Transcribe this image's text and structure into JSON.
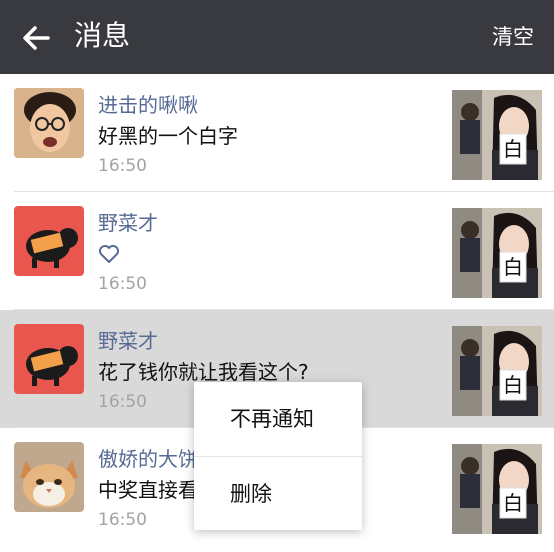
{
  "header": {
    "title": "消息",
    "clear_label": "清空",
    "bg_color": "#393a3f"
  },
  "messages": [
    {
      "name": "进击的啾啾",
      "content": "好黑的一个白字",
      "time": "16:50",
      "avatar": "man-glasses-avatar"
    },
    {
      "name": "野菜才",
      "content": "",
      "content_icon": "heart-icon",
      "time": "16:50",
      "avatar": "pig-avatar"
    },
    {
      "name": "野菜才",
      "content": "花了钱你就让我看这个?",
      "time": "16:50",
      "avatar": "pig-avatar",
      "selected": true
    },
    {
      "name": "傲娇的大饼",
      "content": "中奖直接看",
      "time": "16:50",
      "avatar": "cat-avatar"
    }
  ],
  "thumbnail": {
    "char": "白"
  },
  "context_menu": {
    "items": [
      "不再通知",
      "删除"
    ]
  },
  "colors": {
    "name_link": "#576b95",
    "selected_bg": "#d9d9d9",
    "time_gray": "#a3a3a3"
  }
}
